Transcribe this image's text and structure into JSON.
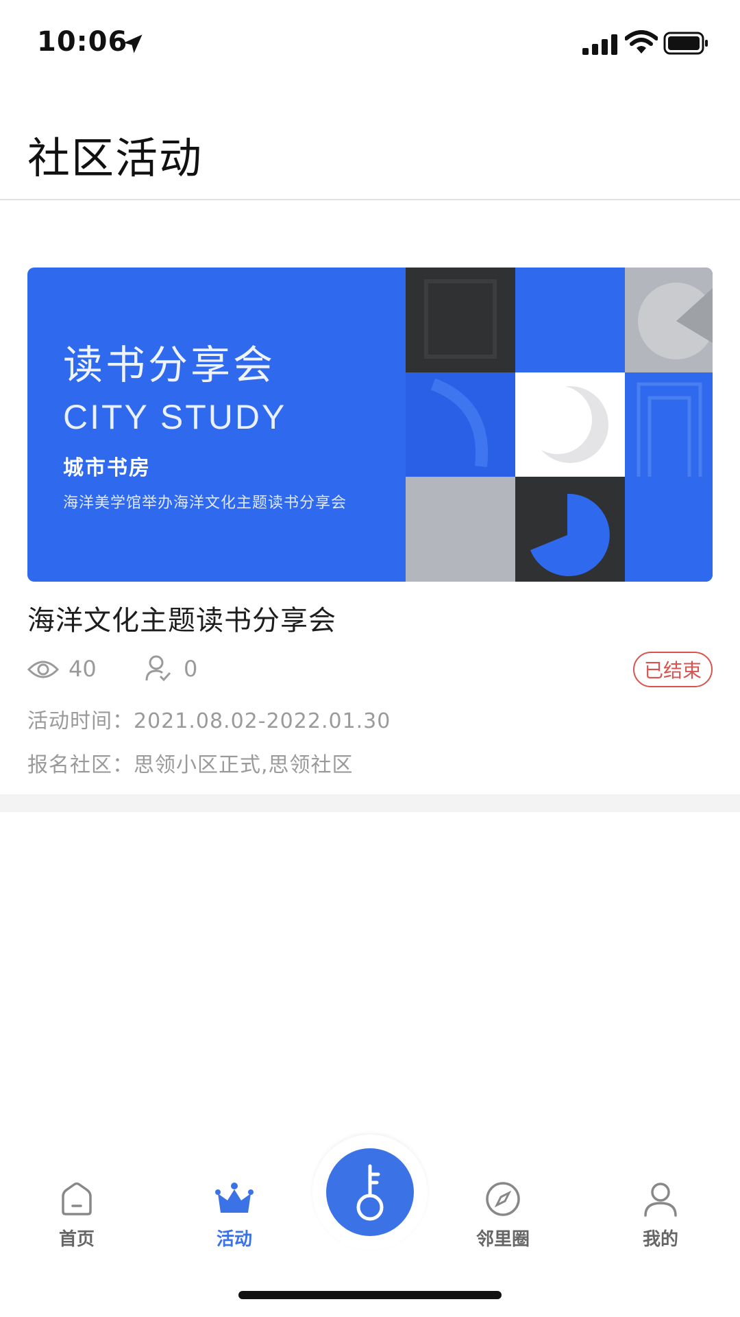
{
  "status_bar": {
    "time": "10:06"
  },
  "header": {
    "title": "社区活动"
  },
  "event": {
    "banner": {
      "title": "读书分享会",
      "subtitle_en": "CITY STUDY",
      "subtitle_cn": "城市书房",
      "description": "海洋美学馆举办海洋文化主题读书分享会"
    },
    "title": "海洋文化主题读书分享会",
    "views": "40",
    "signups": "0",
    "status": "已结束",
    "time_line": "活动时间：2021.08.02-2022.01.30",
    "community_line": "报名社区：思领小区正式,思领社区"
  },
  "tab_bar": {
    "items": [
      {
        "label": "首页",
        "icon": "home-icon"
      },
      {
        "label": "活动",
        "icon": "crown-icon"
      },
      {
        "label": "",
        "icon": "key-icon"
      },
      {
        "label": "邻里圈",
        "icon": "compass-icon"
      },
      {
        "label": "我的",
        "icon": "user-icon"
      }
    ]
  },
  "colors": {
    "accent": "#3b73e6",
    "banner_blue": "#2f69ee",
    "status_red": "#d9534f",
    "meta_gray": "#9a9a9a"
  }
}
